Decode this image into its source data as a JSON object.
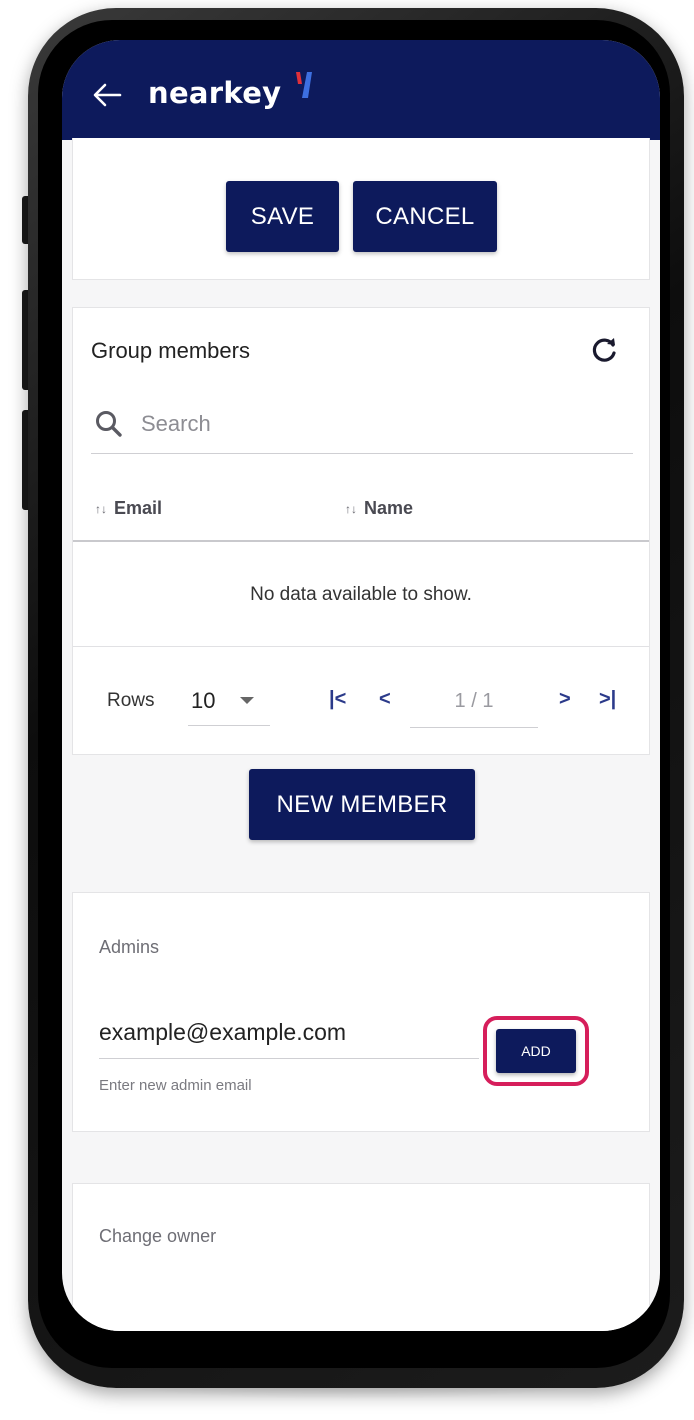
{
  "app_bar": {
    "logo_text": "nearkey",
    "back_icon": "arrow-left-icon",
    "brand_colors": {
      "bar": "#0d1a5c",
      "logo_red": "#e0303a",
      "logo_blue": "#3d6fe0"
    }
  },
  "actions": {
    "save_label": "SAVE",
    "cancel_label": "CANCEL"
  },
  "members": {
    "title": "Group members",
    "refresh_icon": "refresh-icon",
    "search_placeholder": "Search",
    "columns": [
      {
        "label": "Email",
        "sortable": true
      },
      {
        "label": "Name",
        "sortable": true
      }
    ],
    "empty_message": "No data available to show.",
    "paginator": {
      "rows_label": "Rows",
      "rows_value": "10",
      "page_report": "1 / 1"
    },
    "new_member_label": "NEW MEMBER"
  },
  "admins": {
    "title": "Admins",
    "input_value": "example@example.com",
    "hint": "Enter new admin email",
    "add_label": "ADD",
    "highlight_color": "#d61e5b"
  },
  "owner": {
    "title": "Change owner"
  }
}
